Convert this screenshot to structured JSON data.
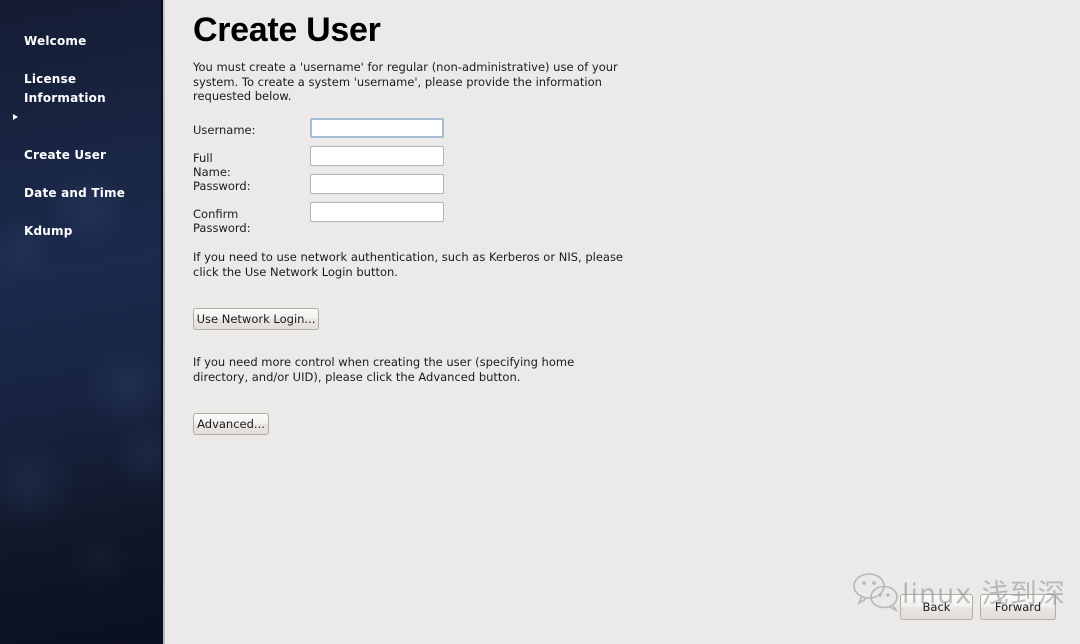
{
  "sidebar": {
    "items": [
      {
        "label": "Welcome",
        "selected": false
      },
      {
        "label": "License\nInformation",
        "selected": false
      },
      {
        "label": "Create User",
        "selected": true
      },
      {
        "label": "Date and Time",
        "selected": false
      },
      {
        "label": "Kdump",
        "selected": false
      }
    ]
  },
  "main": {
    "title": "Create User",
    "intro_text": "You must create a 'username' for regular (non-administrative) use of your system.  To create a system 'username', please provide the information requested below.",
    "network_text": "If you need to use network authentication, such as Kerberos or NIS, please click the Use Network Login button.",
    "network_button_label": "Use Network Login...",
    "advanced_text": "If you need more control when creating the user (specifying home directory, and/or UID), please click the Advanced button.",
    "advanced_button_label": "Advanced...",
    "form": {
      "fields": [
        {
          "label": "Username:",
          "value": "",
          "placeholder": "",
          "focused": true,
          "type": "text"
        },
        {
          "label": "Full Name:",
          "value": "",
          "placeholder": "",
          "focused": false,
          "type": "text"
        },
        {
          "label": "Password:",
          "value": "",
          "placeholder": "",
          "focused": false,
          "type": "password"
        },
        {
          "label": "Confirm Password:",
          "value": "",
          "placeholder": "",
          "focused": false,
          "type": "password"
        }
      ]
    }
  },
  "navigation": {
    "back_label": "Back",
    "forward_label": "Forward"
  },
  "watermark": {
    "icon": "wechat-icon",
    "text": "linux 浅到深"
  },
  "colors": {
    "sidebar_top": "#141c33",
    "sidebar_mid": "#1b2a4d",
    "sidebar_bottom": "#0b1020",
    "panel_background": "#eceae8",
    "focus_border": "#a8bdd4",
    "text": "#1b1b1b"
  }
}
